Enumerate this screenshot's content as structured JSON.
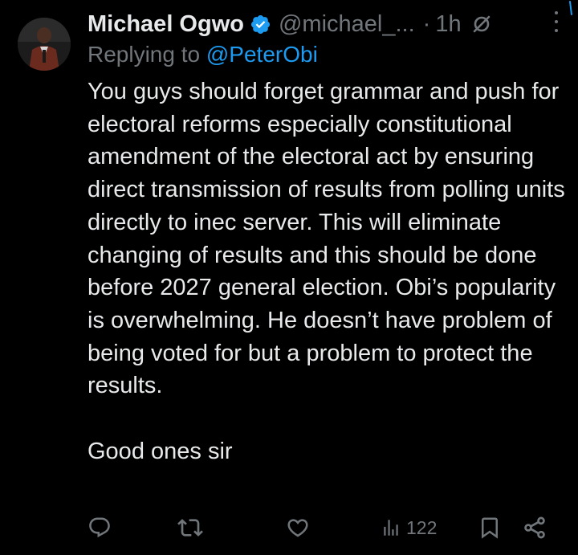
{
  "tweet": {
    "author": {
      "display_name": "Michael Ogwo",
      "handle": "@michael_...",
      "verified": true
    },
    "separator": "·",
    "time": "1h",
    "reply_prefix": "Replying to ",
    "reply_to": "@PeterObi",
    "body": {
      "paragraph_1": "You guys should forget grammar and push for electoral reforms especially constitutional amendment of the electoral act by ensuring direct transmission of results from polling units directly to inec server. This will eliminate changing of results and this should be done before 2027 general election. Obi’s popularity is overwhelming. He doesn’t have problem of being voted for but a problem to protect the results.",
      "paragraph_2": "Good ones sir"
    },
    "actions": {
      "views": "122"
    }
  },
  "icons": {
    "verified": "verified-badge-icon",
    "muted": "mute-icon",
    "more": "more-icon",
    "reply": "reply-icon",
    "retweet": "retweet-icon",
    "like": "like-icon",
    "views": "views-icon",
    "bookmark": "bookmark-icon",
    "share": "share-icon"
  },
  "colors": {
    "background": "#000000",
    "text": "#e7e9ea",
    "muted_text": "#71767b",
    "accent": "#1d9bf0"
  }
}
